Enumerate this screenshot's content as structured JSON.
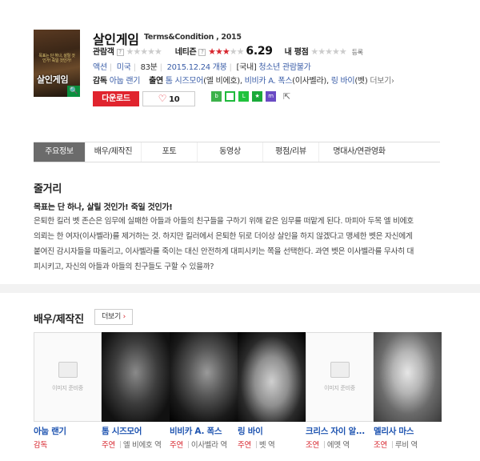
{
  "movie": {
    "title": "살인게임",
    "original_title": "Terms&Condition , 2015",
    "poster_title": "살인게임",
    "poster_tagline": "목표는 단 하나, 살릴 것인가! 죽일 것인가!"
  },
  "ratings": {
    "audience_label": "관람객",
    "netizen_label": "네티즌",
    "netizen_score": "6.29",
    "my_rating_label": "내 평점",
    "register_label": "등록",
    "netizen_stars_filled": 3,
    "stars_total": 5
  },
  "info": {
    "genre": "액션",
    "country": "미국",
    "runtime": "83분",
    "release": "2015.12.24 개봉",
    "grade_prefix": "[국내]",
    "grade": "청소년 관람불가"
  },
  "credits": {
    "director_label": "감독",
    "director": "아눕 랜기",
    "cast_label": "출연",
    "cast": "톰 시즈모어",
    "cast_role": "(엘 비에호),",
    "cast2": "비비카 A. 폭스",
    "cast2_role": "(이사벨라),",
    "cast3": "링 바이",
    "cast3_role": "(벳)",
    "more_label": "더보기"
  },
  "actions": {
    "download_label": "다운로드",
    "like_count": "10"
  },
  "share": [
    "naver-blog",
    "band",
    "line",
    "bookmark",
    "me2day",
    "link"
  ],
  "tabs": [
    "주요정보",
    "배우/제작진",
    "포토",
    "동영상",
    "평점/리뷰",
    "명대사/연관영화"
  ],
  "plot": {
    "section_title": "줄거리",
    "headline": "목표는 단 하나, 살릴 것인가! 죽일 것인가!",
    "body": "은퇴한 킬러 벳 존슨은 임무에 실패한 아들과 아들의 친구들을 구하기 위해 같은 임무를 떠맡게 된다. 마피아 두목 엘 비에호\n의뢰는 한 여자(이사벨라)를 제거하는 것. 하지만 킬러에서 은퇴한 뒤로 더이상 살인을 하지 않겠다고 맹세한 벳은 자신에게\n붙여진 감시자들을 따돌리고, 이사벨라를 죽이는 대신 안전하게 대피시키는 쪽을 선택한다. 과연 벳은 이사벨라를 무사히 대\n피시키고, 자신의 아들과 아들의 친구들도 구할 수 있을까?"
  },
  "people": {
    "section_title": "배우/제작진",
    "more_label": "더보기",
    "placeholder_text": "이미지 준비중",
    "items": [
      {
        "name": "아눕 랜기",
        "role_type": "감독",
        "role_name": "",
        "has_photo": false
      },
      {
        "name": "톰 시즈모어",
        "role_type": "주연",
        "role_name": "엘 비에호 역",
        "has_photo": true
      },
      {
        "name": "비비카 A. 폭스",
        "role_type": "주연",
        "role_name": "이사벨라 역",
        "has_photo": true
      },
      {
        "name": "링 바이",
        "role_type": "주연",
        "role_name": "벳 역",
        "has_photo": true
      },
      {
        "name": "크리스 자이 알...",
        "role_type": "조연",
        "role_name": "에멧 역",
        "has_photo": false
      },
      {
        "name": "멜리사 마스",
        "role_type": "조연",
        "role_name": "루비 역",
        "has_photo": true
      }
    ]
  }
}
